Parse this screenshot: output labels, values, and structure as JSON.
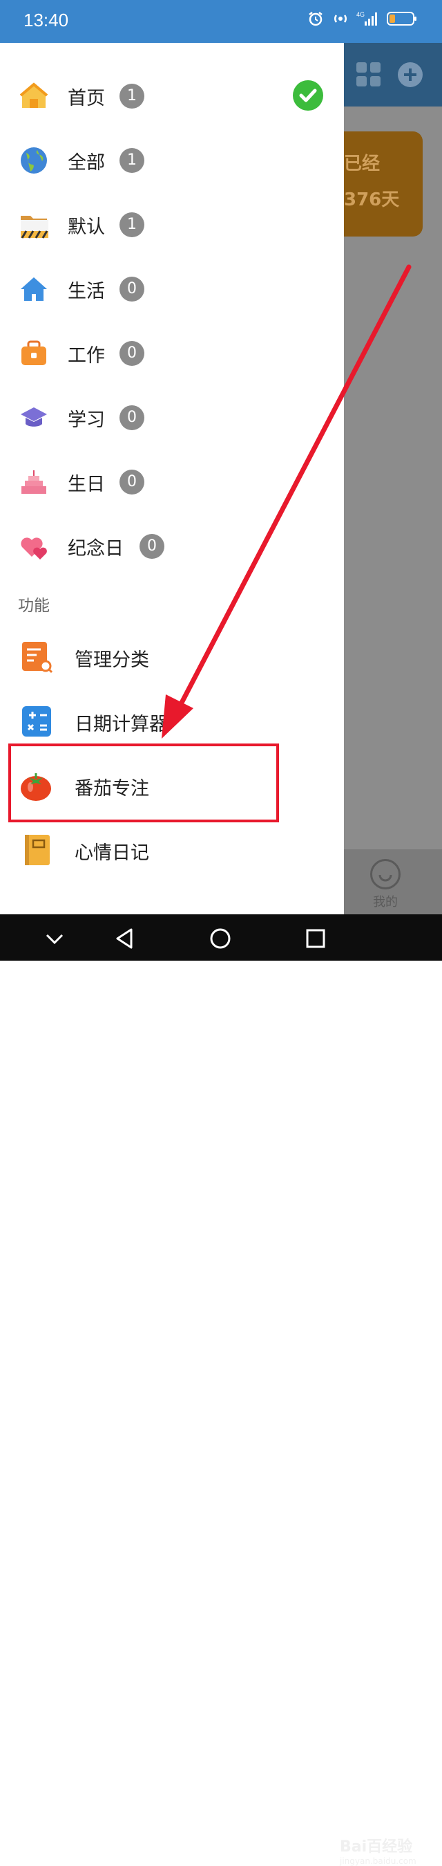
{
  "status_bar": {
    "time": "13:40",
    "network": "4G"
  },
  "background_app": {
    "card_line1": "已经",
    "card_line2": "376天",
    "bottom_tab_label": "我的"
  },
  "drawer": {
    "categories": [
      {
        "label": "首页",
        "count": "1",
        "icon": "house-icon",
        "selected": true
      },
      {
        "label": "全部",
        "count": "1",
        "icon": "globe-icon"
      },
      {
        "label": "默认",
        "count": "1",
        "icon": "folder-icon"
      },
      {
        "label": "生活",
        "count": "0",
        "icon": "home-icon"
      },
      {
        "label": "工作",
        "count": "0",
        "icon": "briefcase-icon"
      },
      {
        "label": "学习",
        "count": "0",
        "icon": "graduation-cap-icon"
      },
      {
        "label": "生日",
        "count": "0",
        "icon": "cake-icon"
      },
      {
        "label": "纪念日",
        "count": "0",
        "icon": "hearts-icon"
      }
    ],
    "section_title": "功能",
    "functions": [
      {
        "label": "管理分类",
        "icon": "list-search-icon"
      },
      {
        "label": "日期计算器",
        "icon": "calculator-icon"
      },
      {
        "label": "番茄专注",
        "icon": "tomato-icon"
      },
      {
        "label": "心情日记",
        "icon": "notebook-icon"
      }
    ]
  },
  "watermark": {
    "logo": "Bai百经验",
    "url": "jingyan.baidu.com"
  },
  "colors": {
    "status_bar": "#3a86cc",
    "check": "#3cbc3c",
    "annotation": "#e8192c",
    "badge": "#8a8a8a"
  }
}
